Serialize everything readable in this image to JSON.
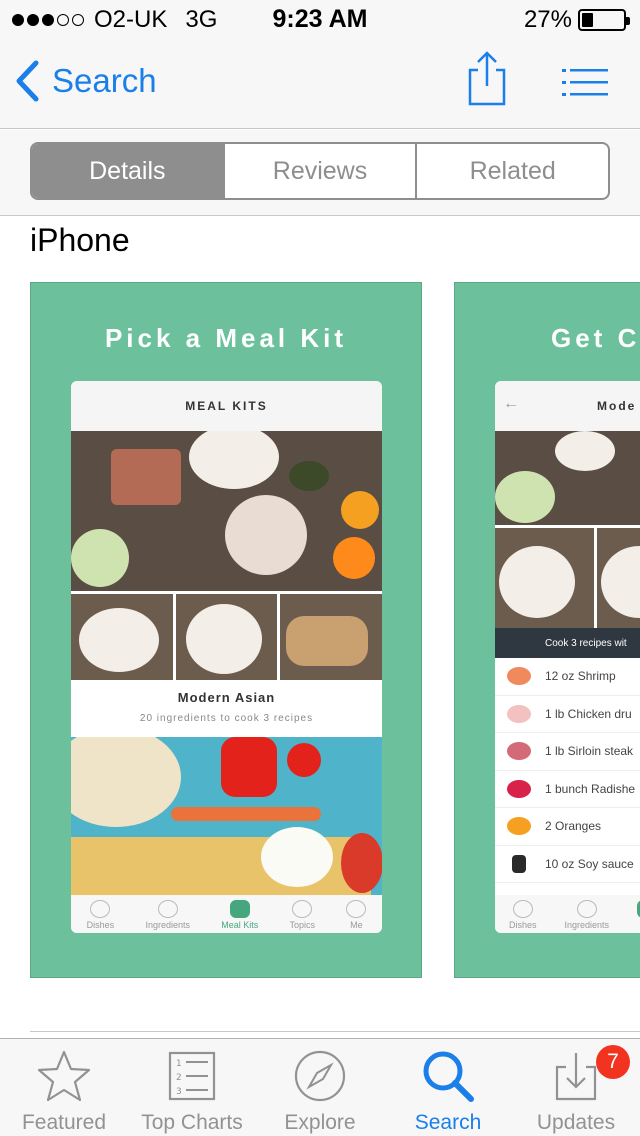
{
  "status_bar": {
    "carrier": "O2-UK",
    "network": "3G",
    "time": "9:23 AM",
    "battery_percent": "27%",
    "battery_level": 0.27,
    "signal_bars_full": 3,
    "signal_bars_total": 5
  },
  "nav": {
    "back_label": "Search",
    "share_icon": "share-icon",
    "list_icon": "list-icon"
  },
  "segments": [
    {
      "label": "Details",
      "active": true
    },
    {
      "label": "Reviews",
      "active": false
    },
    {
      "label": "Related",
      "active": false
    }
  ],
  "device_label": "iPhone",
  "screenshots": [
    {
      "title": "Pick a Meal Kit",
      "header": "MEAL KITS",
      "meal_name": "Modern Asian",
      "meal_sub": "20 ingredients to cook 3 recipes",
      "tabs": [
        "Dishes",
        "Ingredients",
        "Meal Kits",
        "Topics",
        "Me"
      ]
    },
    {
      "title": "Get C",
      "header": "Mode",
      "banner": "Cook 3 recipes wit",
      "ingredients": [
        "12 oz Shrimp",
        "1 lb Chicken dru",
        "1 lb Sirloin steak",
        "1 bunch Radishe",
        "2 Oranges",
        "10 oz Soy sauce"
      ],
      "tabs": [
        "Dishes",
        "Ingredients",
        "M"
      ]
    }
  ],
  "tabbar": [
    {
      "label": "Featured",
      "icon": "star-icon",
      "active": false
    },
    {
      "label": "Top Charts",
      "icon": "top-charts-icon",
      "active": false
    },
    {
      "label": "Explore",
      "icon": "compass-icon",
      "active": false
    },
    {
      "label": "Search",
      "icon": "search-icon",
      "active": true
    },
    {
      "label": "Updates",
      "icon": "updates-icon",
      "active": false,
      "badge": "7"
    }
  ],
  "colors": {
    "accent": "#1a7fe8",
    "screenshot_bg": "#6cc19c",
    "badge": "#f2331f"
  }
}
